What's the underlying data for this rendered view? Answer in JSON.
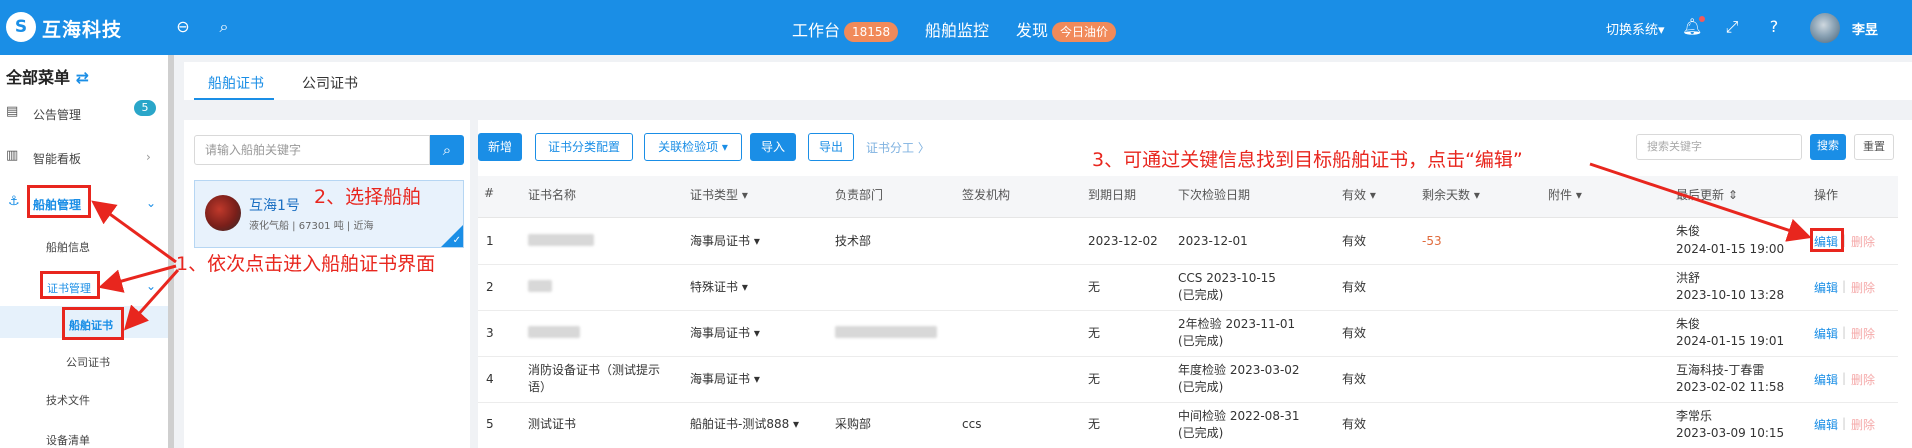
{
  "header": {
    "brand": "互海科技",
    "nav": [
      {
        "label": "工作台",
        "badge": "18158"
      },
      {
        "label": "船舶监控"
      },
      {
        "label": "发现",
        "badge": "今日油价"
      }
    ],
    "switch_system": "切换系统▾",
    "user_name": "李昱"
  },
  "sidebar": {
    "title": "全部菜单",
    "items": [
      {
        "label": "公告管理",
        "badge": "5"
      },
      {
        "label": "智能看板"
      },
      {
        "label": "船舶管理"
      },
      {
        "label": "船舶信息"
      },
      {
        "label": "证书管理"
      },
      {
        "label": "船舶证书"
      },
      {
        "label": "公司证书"
      },
      {
        "label": "技术文件"
      },
      {
        "label": "设备清单"
      }
    ]
  },
  "tabs": [
    "船舶证书",
    "公司证书"
  ],
  "ship_list": {
    "search_placeholder": "请输入船舶关键字",
    "ships": [
      {
        "name": "互海1号",
        "sub": "液化气船 | 67301 吨 | 近海"
      }
    ]
  },
  "toolbar": {
    "buttons": [
      "新增",
      "证书分类配置",
      "关联检验项 ▾",
      "导入",
      "导出"
    ],
    "link": "证书分工 〉",
    "keyword_placeholder": "搜索关键字",
    "search": "搜索",
    "reset": "重置"
  },
  "table": {
    "headers": [
      "#",
      "证书名称",
      "证书类型 ▾",
      "负责部门",
      "签发机构",
      "到期日期",
      "下次检验日期",
      "有效 ▾",
      "剩余天数 ▾",
      "附件 ▾",
      "最后更新 ⇕",
      "操作"
    ],
    "rows": [
      {
        "no": "1",
        "name": "",
        "type": "海事局证书 ▾",
        "dept": "技术部",
        "issuer": "",
        "expire": "2023-12-02",
        "next1": "2023-12-01",
        "next2": "",
        "valid": "有效",
        "days": "-53",
        "upd_by": "朱俊",
        "upd_at": "2024-01-15 19:00"
      },
      {
        "no": "2",
        "name": "",
        "type": "特殊证书 ▾",
        "dept": "",
        "issuer": "",
        "expire": "无",
        "next1": "CCS 2023-10-15",
        "next2": "(已完成)",
        "valid": "有效",
        "days": "",
        "upd_by": "洪舒",
        "upd_at": "2023-10-10 13:28"
      },
      {
        "no": "3",
        "name": "",
        "type": "海事局证书 ▾",
        "dept": "",
        "issuer": "",
        "expire": "无",
        "next1": "2年检验 2023-11-01",
        "next2": "(已完成)",
        "valid": "有效",
        "days": "",
        "upd_by": "朱俊",
        "upd_at": "2024-01-15 19:01"
      },
      {
        "no": "4",
        "name": "消防设备证书（测试提示",
        "name2": "语）",
        "type": "海事局证书 ▾",
        "dept": "",
        "issuer": "",
        "expire": "无",
        "next1": "年度检验 2023-03-02",
        "next2": "(已完成)",
        "valid": "有效",
        "days": "",
        "upd_by": "互海科技-丁春雷",
        "upd_at": "2023-02-02 11:58"
      },
      {
        "no": "5",
        "name": "测试证书",
        "type": "船舶证书-测试888 ▾",
        "dept": "采购部",
        "issuer": "ccs",
        "expire": "无",
        "next1": "中间检验 2022-08-31",
        "next2": "(已完成)",
        "valid": "有效",
        "days": "",
        "upd_by": "李常乐",
        "upd_at": "2023-03-09 10:15"
      }
    ],
    "edit_label": "编辑",
    "delete_label": "删除"
  },
  "annotations": {
    "step1": "1、依次点击进入船舶证书界面",
    "step2": "2、选择船舶",
    "step3": "3、可通过关键信息找到目标船舶证书，点击“编辑”"
  },
  "colors": {
    "primary": "#1a8ee6",
    "annotation": "#e8261e",
    "badge_orange": "#f18a5a"
  }
}
